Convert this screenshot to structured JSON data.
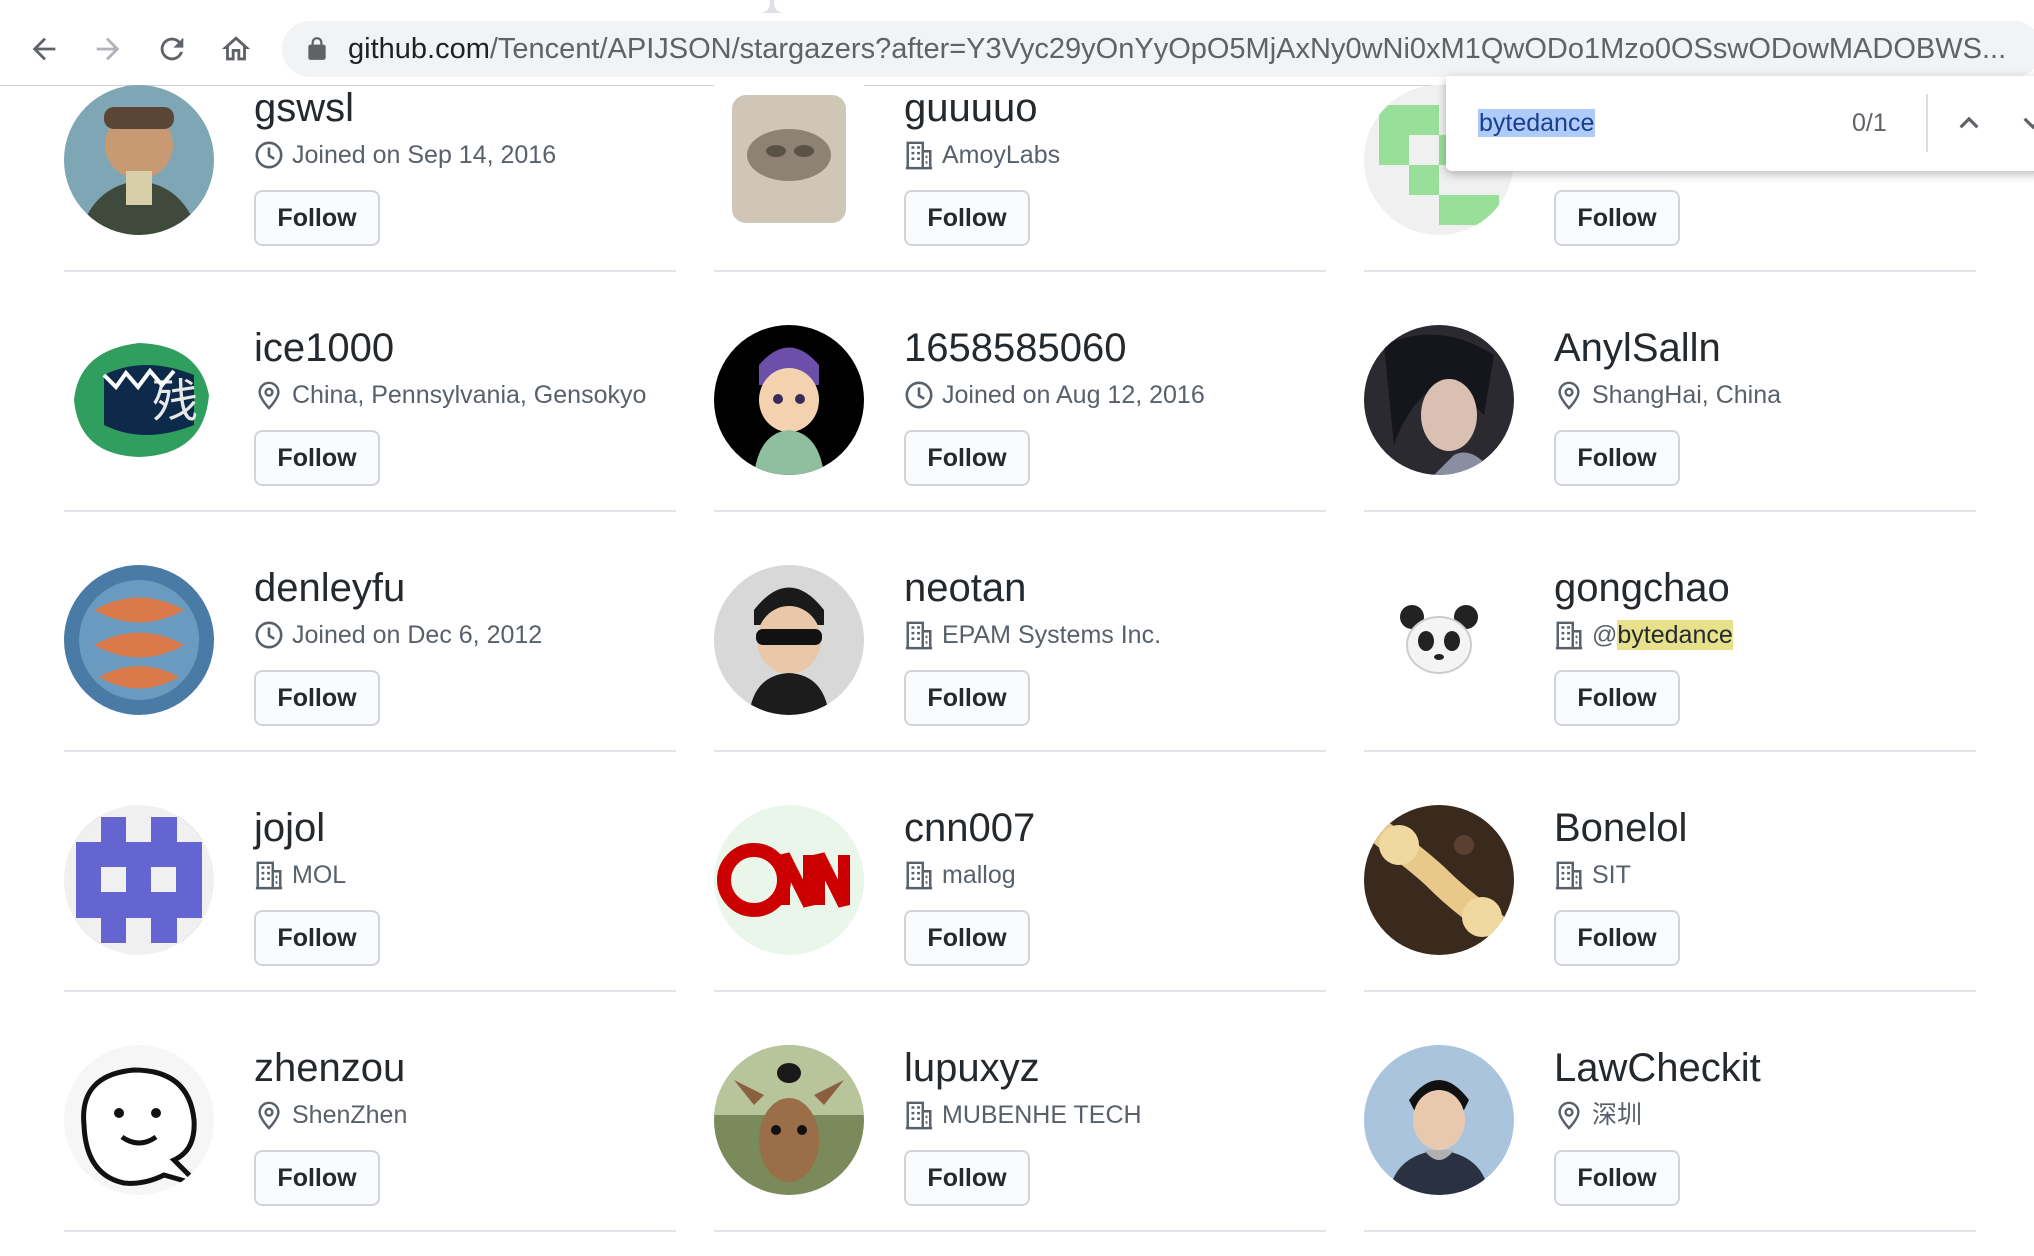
{
  "browser": {
    "url_domain": "github.com",
    "url_path": "/Tencent/APIJSON/stargazers?after=Y3Vyc29yOnYyOpO5MjAxNy0wNi0xM1QwODo1Mzo0OSswODowMADOBWS..."
  },
  "find_bar": {
    "query": "bytedance",
    "count": "0/1"
  },
  "follow_label": "Follow",
  "users": [
    {
      "name": "gswsl",
      "meta_icon": "clock-icon",
      "meta": "Joined on Sep 14, 2016"
    },
    {
      "name": "guuuuo",
      "meta_icon": "organization-icon",
      "meta": "AmoyLabs"
    },
    {
      "name": "",
      "meta_icon": "",
      "meta": ""
    },
    {
      "name": "ice1000",
      "meta_icon": "location-icon",
      "meta": "China, Pennsylvania, Gensokyo"
    },
    {
      "name": "1658585060",
      "meta_icon": "clock-icon",
      "meta": "Joined on Aug 12, 2016"
    },
    {
      "name": "AnylSalln",
      "meta_icon": "location-icon",
      "meta": "ShangHai, China"
    },
    {
      "name": "denleyfu",
      "meta_icon": "clock-icon",
      "meta": "Joined on Dec 6, 2012"
    },
    {
      "name": "neotan",
      "meta_icon": "organization-icon",
      "meta": "EPAM Systems Inc."
    },
    {
      "name": "gongchao",
      "meta_icon": "organization-icon",
      "meta_prefix": "@",
      "meta_highlight": "bytedance"
    },
    {
      "name": "jojol",
      "meta_icon": "organization-icon",
      "meta": "MOL"
    },
    {
      "name": "cnn007",
      "meta_icon": "organization-icon",
      "meta": "mallog"
    },
    {
      "name": "Bonelol",
      "meta_icon": "organization-icon",
      "meta": "SIT"
    },
    {
      "name": "zhenzou",
      "meta_icon": "location-icon",
      "meta": "ShenZhen"
    },
    {
      "name": "lupuxyz",
      "meta_icon": "organization-icon",
      "meta": "MUBENHE TECH"
    },
    {
      "name": "LawCheckit",
      "meta_icon": "location-icon",
      "meta": "深圳"
    }
  ],
  "colors": {
    "highlight": "#e6e18a",
    "find_selection": "#aecbfa",
    "divider": "#e1e4e8"
  }
}
